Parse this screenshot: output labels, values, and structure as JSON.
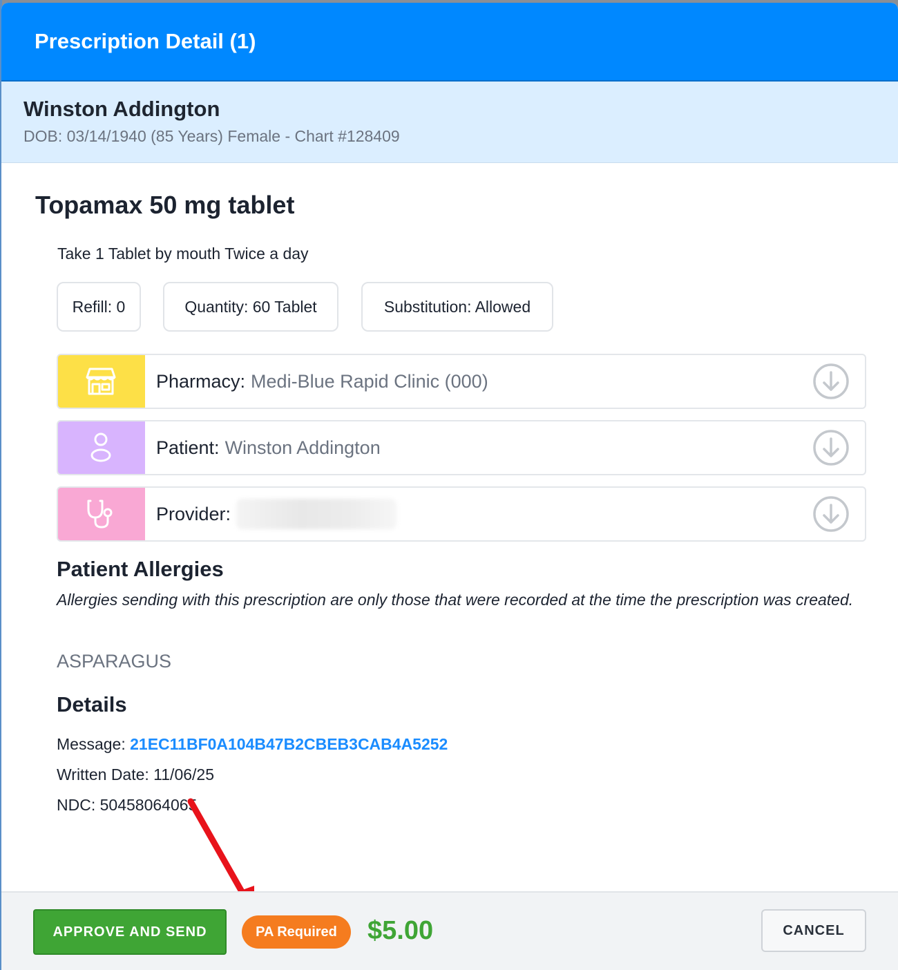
{
  "modal": {
    "title": "Prescription Detail (1)"
  },
  "patient": {
    "name": "Winston Addington",
    "meta": "DOB: 03/14/1940 (85 Years) Female - Chart #128409"
  },
  "prescription": {
    "drug": "Topamax 50 mg tablet",
    "sig": "Take 1 Tablet by mouth Twice a day",
    "chips": [
      "Refill: 0",
      "Quantity: 60 Tablet",
      "Substitution: Allowed"
    ]
  },
  "rows": {
    "pharmacy": {
      "label": "Pharmacy:",
      "value": "Medi-Blue Rapid Clinic (000)",
      "icon": "store-icon",
      "color": "#fde047"
    },
    "patient": {
      "label": "Patient:",
      "value": "Winston Addington",
      "icon": "person-icon",
      "color": "#d8b4fe"
    },
    "provider": {
      "label": "Provider:",
      "value": "",
      "icon": "stethoscope-icon",
      "color": "#f9a8d4"
    }
  },
  "allergies": {
    "heading": "Patient Allergies",
    "note": "Allergies sending with this prescription are only those that were recorded at the time the prescription was created.",
    "items": [
      "ASPARAGUS"
    ]
  },
  "details": {
    "heading": "Details",
    "message_label": "Message: ",
    "message_value": "21EC11BF0A104B47B2CBEB3CAB4A5252",
    "written_date": "Written Date: 11/06/25",
    "ndc": "NDC: 50458064065"
  },
  "footer": {
    "approve_label": "APPROVE AND SEND",
    "pa_badge": "PA Required",
    "price": "$5.00",
    "cancel_label": "CANCEL"
  },
  "colors": {
    "header": "#0088ff",
    "approve": "#3fa535",
    "pa_badge": "#f57c1f",
    "annotation_arrow": "#e8131b"
  }
}
